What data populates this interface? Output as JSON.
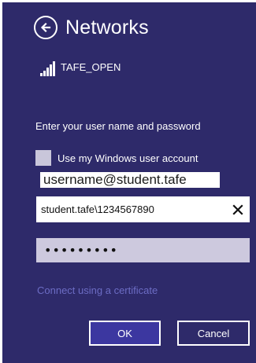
{
  "header": {
    "title": "Networks",
    "back_icon": "back-arrow-circle-icon"
  },
  "network": {
    "ssid": "TAFE_OPEN",
    "signal_icon": "wifi-signal-icon",
    "signal_bars": 4
  },
  "form": {
    "prompt": "Enter your user name and password",
    "checkbox_label": "Use my Windows user account",
    "checkbox_checked": false,
    "caption": "username@student.tafe",
    "username_value": "student.tafe\\1234567890",
    "password_mask": "•••••••••",
    "clear_icon": "close-icon"
  },
  "links": {
    "certificate": "Connect using a certificate"
  },
  "buttons": {
    "ok": "OK",
    "cancel": "Cancel"
  },
  "colors": {
    "background": "#2e2a6a",
    "accent_button": "#3c37a0",
    "link": "#6c6cc4",
    "input_inactive": "#cdc9de"
  }
}
